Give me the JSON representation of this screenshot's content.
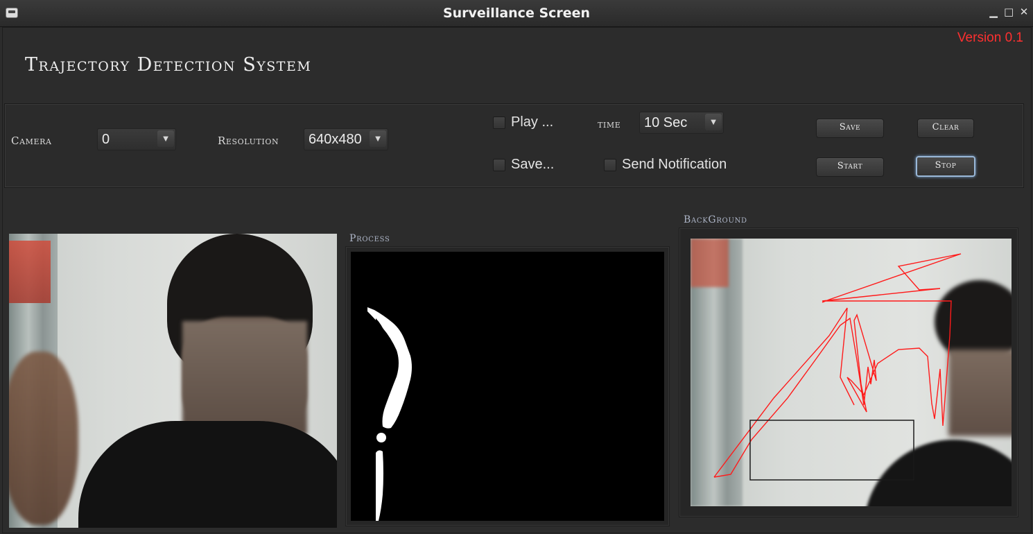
{
  "window": {
    "title": "Surveillance Screen",
    "controls": {
      "minimize": "▁",
      "maximize": "□",
      "close": "✕"
    }
  },
  "header": {
    "version": "Version 0.1",
    "app_title": "Trajectory Detection System"
  },
  "controls": {
    "camera_label": "Camera",
    "camera_value": "0",
    "resolution_label": "Resolution",
    "resolution_value": "640x480",
    "play_label": "Play ...",
    "save_check_label": "Save...",
    "time_label": "time",
    "time_value": "10 Sec",
    "send_notification_label": "Send Notification",
    "buttons": {
      "save": "Save",
      "clear": "Clear",
      "start": "Start",
      "stop": "Stop"
    }
  },
  "panels": {
    "process_label": "Process",
    "background_label": "BackGround"
  },
  "colors": {
    "version_text": "#ff3030",
    "trajectory": "#ff1a1a",
    "background": "#2c2c2c"
  },
  "icons": {
    "dropdown": "▼"
  }
}
